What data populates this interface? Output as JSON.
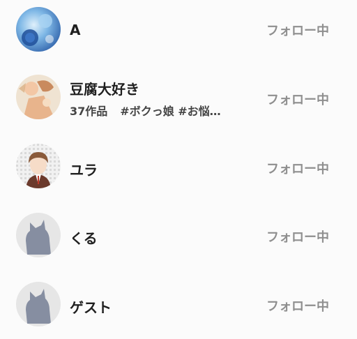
{
  "users": [
    {
      "name": "A",
      "meta_count": "",
      "meta_tags": "",
      "follow_label": "フォロー中",
      "avatar": "blue-rose-art"
    },
    {
      "name": "豆腐大好き",
      "meta_count": "37作品",
      "meta_tags": "#ボクっ娘 #お悩…",
      "follow_label": "フォロー中",
      "avatar": "illustration-girl-hands"
    },
    {
      "name": "ユラ",
      "meta_count": "",
      "meta_tags": "",
      "follow_label": "フォロー中",
      "avatar": "anime-boy-portrait"
    },
    {
      "name": "くる",
      "meta_count": "",
      "meta_tags": "",
      "follow_label": "フォロー中",
      "avatar": "default-cat-icon"
    },
    {
      "name": "ゲスト",
      "meta_count": "",
      "meta_tags": "",
      "follow_label": "フォロー中",
      "avatar": "default-cat-icon"
    }
  ]
}
